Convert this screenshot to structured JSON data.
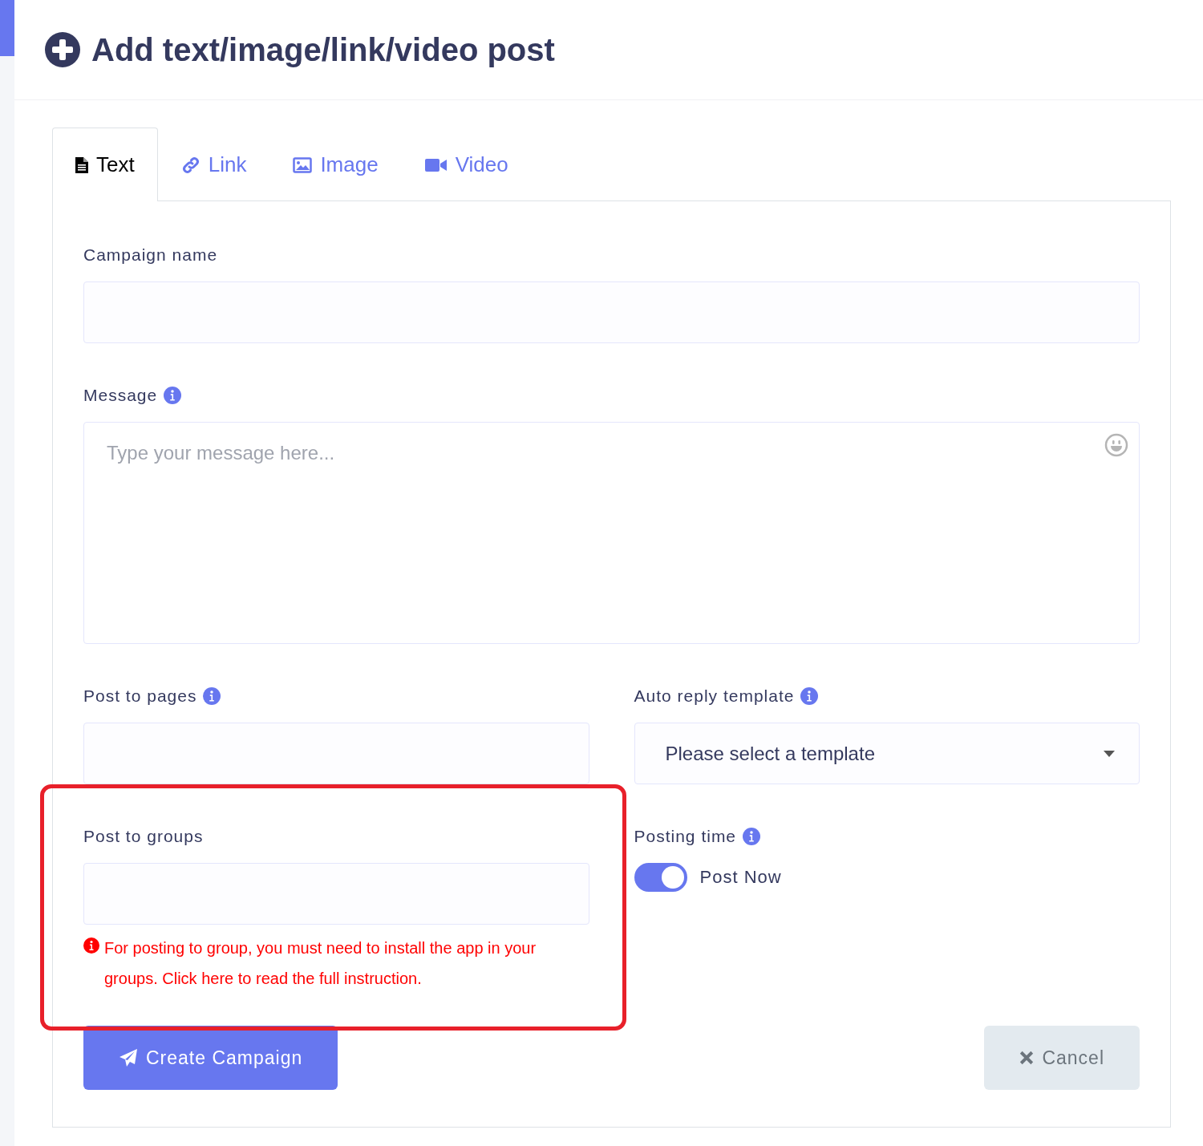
{
  "header": {
    "title": "Add text/image/link/video post"
  },
  "tabs": [
    {
      "label": "Text",
      "selected": true
    },
    {
      "label": "Link",
      "selected": false
    },
    {
      "label": "Image",
      "selected": false
    },
    {
      "label": "Video",
      "selected": false
    }
  ],
  "campaign_name": {
    "label": "Campaign name"
  },
  "message": {
    "label": "Message",
    "info": true,
    "placeholder": "Type your message here..."
  },
  "post_to_pages": {
    "label": "Post to pages",
    "info": true
  },
  "auto_reply_template": {
    "label": "Auto reply template",
    "info": true,
    "value": "Please select a template"
  },
  "post_to_groups": {
    "label": "Post to groups",
    "highlighted": true,
    "notice": "For posting to group, you must need to install the app in your groups. Click here to read the full instruction."
  },
  "posting_time": {
    "label": "Posting time",
    "info": true,
    "toggle": {
      "on": true,
      "label": "Post Now"
    }
  },
  "buttons": [
    {
      "kind": "primary",
      "label": "Create Campaign"
    },
    {
      "kind": "secondary",
      "label": "Cancel"
    }
  ]
}
